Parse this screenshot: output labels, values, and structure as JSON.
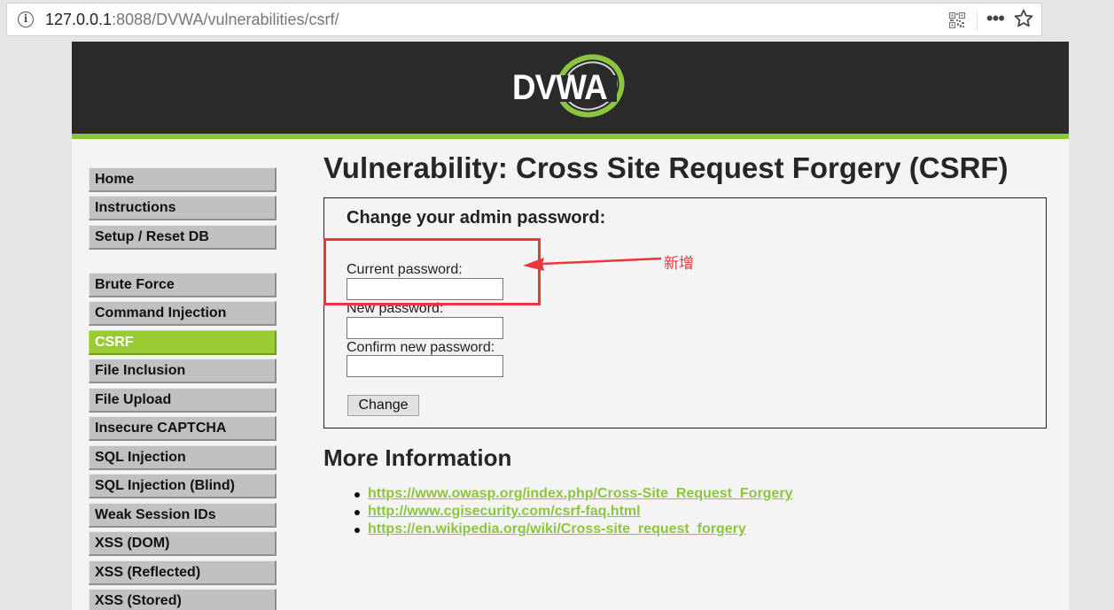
{
  "browser": {
    "url_host": "127.0.0.1",
    "url_rest": ":8088/DVWA/vulnerabilities/csrf/",
    "icons": [
      "info-icon",
      "qr-code-icon",
      "more-icon",
      "bookmark-star-icon"
    ]
  },
  "header": {
    "logo_text": "DVWA",
    "colors": {
      "header_bg": "#2a2a2a",
      "accent": "#8cc63f"
    }
  },
  "menu": {
    "items": [
      {
        "label": "Home"
      },
      {
        "label": "Instructions"
      },
      {
        "label": "Setup / Reset DB"
      },
      {
        "label": "Brute Force"
      },
      {
        "label": "Command Injection"
      },
      {
        "label": "CSRF",
        "selected": true
      },
      {
        "label": "File Inclusion"
      },
      {
        "label": "File Upload"
      },
      {
        "label": "Insecure CAPTCHA"
      },
      {
        "label": "SQL Injection"
      },
      {
        "label": "SQL Injection (Blind)"
      },
      {
        "label": "Weak Session IDs"
      },
      {
        "label": "XSS (DOM)"
      },
      {
        "label": "XSS (Reflected)"
      },
      {
        "label": "XSS (Stored)"
      }
    ]
  },
  "main": {
    "title": "Vulnerability: Cross Site Request Forgery (CSRF)",
    "form": {
      "heading": "Change your admin password:",
      "current_label": "Current password:",
      "current_value": "",
      "new_label": "New password:",
      "new_value": "",
      "confirm_label": "Confirm new password:",
      "confirm_value": "",
      "submit_label": "Change"
    },
    "more_info": {
      "title": "More Information",
      "links": [
        "https://www.owasp.org/index.php/Cross-Site_Request_Forgery",
        "http://www.cgisecurity.com/csrf-faq.html",
        "https://en.wikipedia.org/wiki/Cross-site_request_forgery"
      ]
    }
  },
  "annotation": {
    "text": "新增",
    "color": "#e8383d"
  }
}
